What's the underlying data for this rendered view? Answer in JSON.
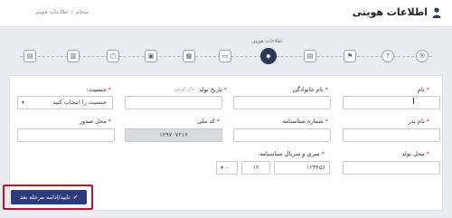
{
  "header": {
    "title": "اطلاعات هویتی",
    "breadcrumb": [
      "سجام",
      "/",
      "اطلاعات هویتی"
    ]
  },
  "steps": {
    "active_caption": "اطلاعات هویتی",
    "items": [
      "®",
      "?",
      "⚑",
      "◆",
      "▤",
      "▭",
      "▦",
      "▣",
      "▢",
      "▥",
      "▤"
    ]
  },
  "form": {
    "first_name": {
      "label": "نام",
      "value": ""
    },
    "last_name": {
      "label": "نام خانوادگی",
      "value": ""
    },
    "birth_date": {
      "label": "تاریخ تولد",
      "hint": "پاک کردن",
      "value": ""
    },
    "gender": {
      "label": "جنسیت:",
      "selected": "جنسیت را انتخاب کنید"
    },
    "father_name": {
      "label": "نام پدر",
      "value": ""
    },
    "id_number": {
      "label": "شماره شناسنامه",
      "value": ""
    },
    "national_code": {
      "label": "کد ملی",
      "value": "۱۲۹۷۰۷۲۱۶"
    },
    "issue_place": {
      "label": "محل صدور",
      "value": ""
    },
    "birth_place": {
      "label": "محل تولد",
      "value": ""
    },
    "serial": {
      "label": "سری و سریال شناسنامه:",
      "part1": "۱۲۳۴۵۶",
      "part2": "۱۲",
      "part3": "-"
    }
  },
  "actions": {
    "submit_label": "تایید/ادامه مرحله بعد",
    "submit_icon": "check-icon"
  },
  "colors": {
    "primary": "#2d3a7d",
    "active_step": "#2d3a55",
    "required": "#d32f2f",
    "highlight": "#c8102e"
  }
}
